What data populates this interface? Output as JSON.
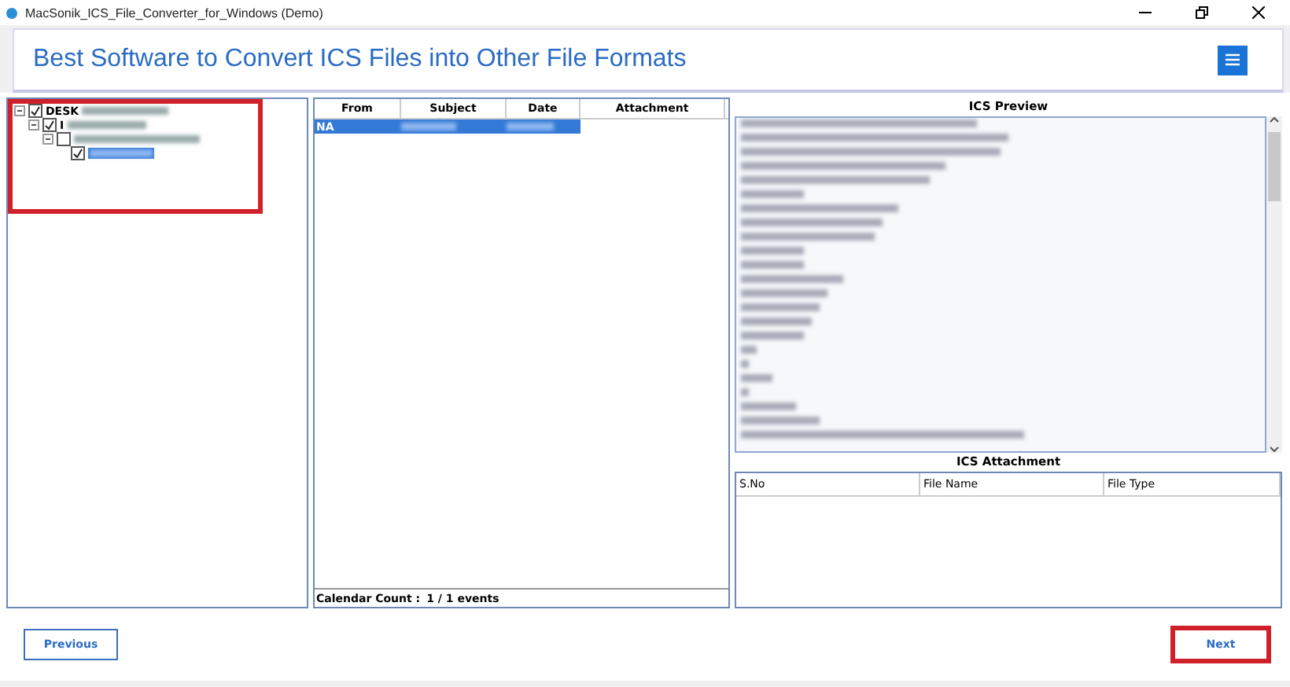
{
  "window": {
    "title": "MacSonik_ICS_File_Converter_for_Windows (Demo)"
  },
  "header": {
    "title": "Best Software to Convert ICS Files into Other File Formats"
  },
  "tree": {
    "highlighted": true,
    "nodes": [
      {
        "label": "DESK",
        "checked": true,
        "expanded": true,
        "selected": false,
        "children": [
          {
            "label": "I",
            "checked": true,
            "expanded": true,
            "selected": false,
            "children": [
              {
                "checked": false,
                "expanded": true,
                "selected": false,
                "children": [
                  {
                    "checked": true,
                    "selected": true
                  }
                ]
              }
            ]
          }
        ]
      }
    ]
  },
  "events": {
    "columns": [
      "From",
      "Subject",
      "Date",
      "Attachment"
    ],
    "rows": [
      {
        "from": "NA",
        "selected": true
      }
    ],
    "count_label": "Calendar Count :",
    "count_value": "1 / 1 events"
  },
  "preview": {
    "title": "ICS Preview"
  },
  "attachments": {
    "title": "ICS Attachment",
    "columns": [
      "S.No",
      "File Name",
      "File Type"
    ]
  },
  "buttons": [
    {
      "label": "Previous",
      "highlighted": false
    },
    {
      "label": "Next",
      "highlighted": true
    }
  ]
}
